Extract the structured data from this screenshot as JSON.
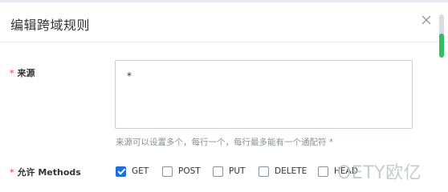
{
  "dialog": {
    "title": "编辑跨域规则",
    "close_icon": "close-icon"
  },
  "form": {
    "origin": {
      "required_mark": "*",
      "label": "来源",
      "value": "*",
      "hint": "来源可以设置多个，每行一个，每行最多能有一个通配符 *"
    },
    "methods": {
      "required_mark": "*",
      "label": "允许 Methods",
      "options": [
        {
          "label": "GET",
          "checked": true
        },
        {
          "label": "POST",
          "checked": false
        },
        {
          "label": "PUT",
          "checked": false
        },
        {
          "label": "DELETE",
          "checked": false
        },
        {
          "label": "HEAD",
          "checked": false
        }
      ]
    }
  },
  "watermark": {
    "text": "OETY欧亿"
  },
  "colors": {
    "accent": "#1f6fd6",
    "required": "#e53935",
    "scroll_thumb": "#2fbf61",
    "hint": "#8a8f99"
  }
}
